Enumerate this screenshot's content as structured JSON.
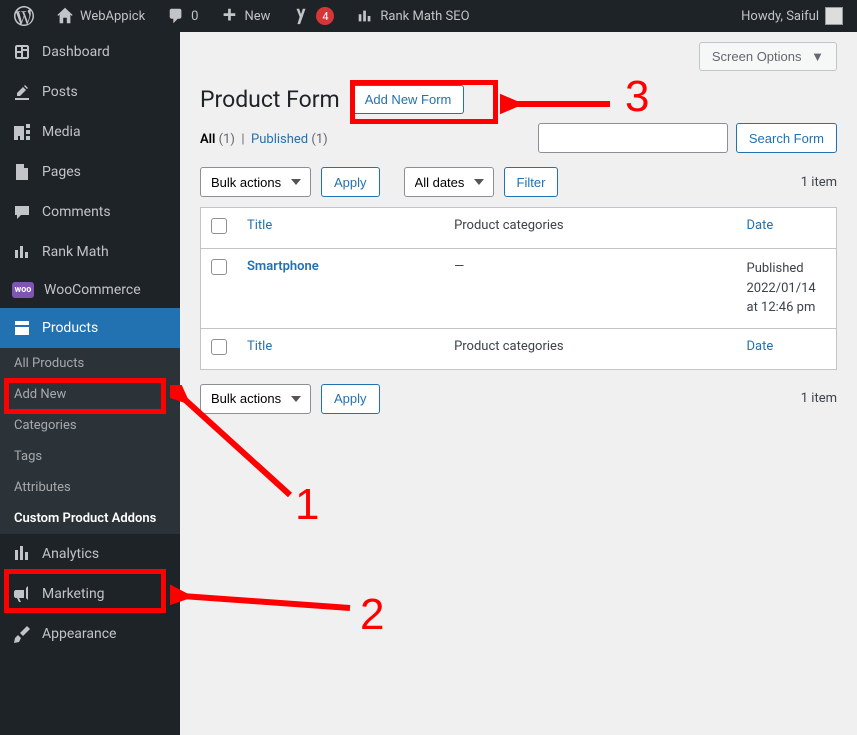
{
  "admin_bar": {
    "site_name": "WebAppick",
    "comment_count": "0",
    "new_label": "New",
    "notif_count": "4",
    "rank_math_label": "Rank Math SEO",
    "howdy": "Howdy, Saiful"
  },
  "sidebar": {
    "items": [
      {
        "label": "Dashboard",
        "icon": "dashboard"
      },
      {
        "label": "Posts",
        "icon": "pin"
      },
      {
        "label": "Media",
        "icon": "media"
      },
      {
        "label": "Pages",
        "icon": "page"
      },
      {
        "label": "Comments",
        "icon": "comment"
      },
      {
        "label": "Rank Math",
        "icon": "chart"
      },
      {
        "label": "WooCommerce",
        "icon": "woo"
      },
      {
        "label": "Products",
        "icon": "product",
        "active": true
      },
      {
        "label": "Analytics",
        "icon": "analytics"
      },
      {
        "label": "Marketing",
        "icon": "megaphone"
      },
      {
        "label": "Appearance",
        "icon": "brush"
      }
    ],
    "submenu": [
      {
        "label": "All Products"
      },
      {
        "label": "Add New"
      },
      {
        "label": "Categories"
      },
      {
        "label": "Tags"
      },
      {
        "label": "Attributes"
      },
      {
        "label": "Custom Product Addons",
        "current": true
      }
    ]
  },
  "page": {
    "title": "Product Form",
    "add_new": "Add New Form",
    "screen_options": "Screen Options"
  },
  "filters": {
    "all_label": "All",
    "all_count": "(1)",
    "published_label": "Published",
    "published_count": "(1)",
    "search_btn": "Search Form",
    "bulk_actions": "Bulk actions",
    "apply": "Apply",
    "all_dates": "All dates",
    "filter": "Filter",
    "item_count": "1 item"
  },
  "table": {
    "cols": {
      "title": "Title",
      "categories": "Product categories",
      "date": "Date"
    },
    "rows": [
      {
        "title": "Smartphone",
        "categories": "—",
        "date": "Published 2022/01/14 at 12:46 pm"
      }
    ]
  },
  "annotations": {
    "n1": "1",
    "n2": "2",
    "n3": "3"
  }
}
